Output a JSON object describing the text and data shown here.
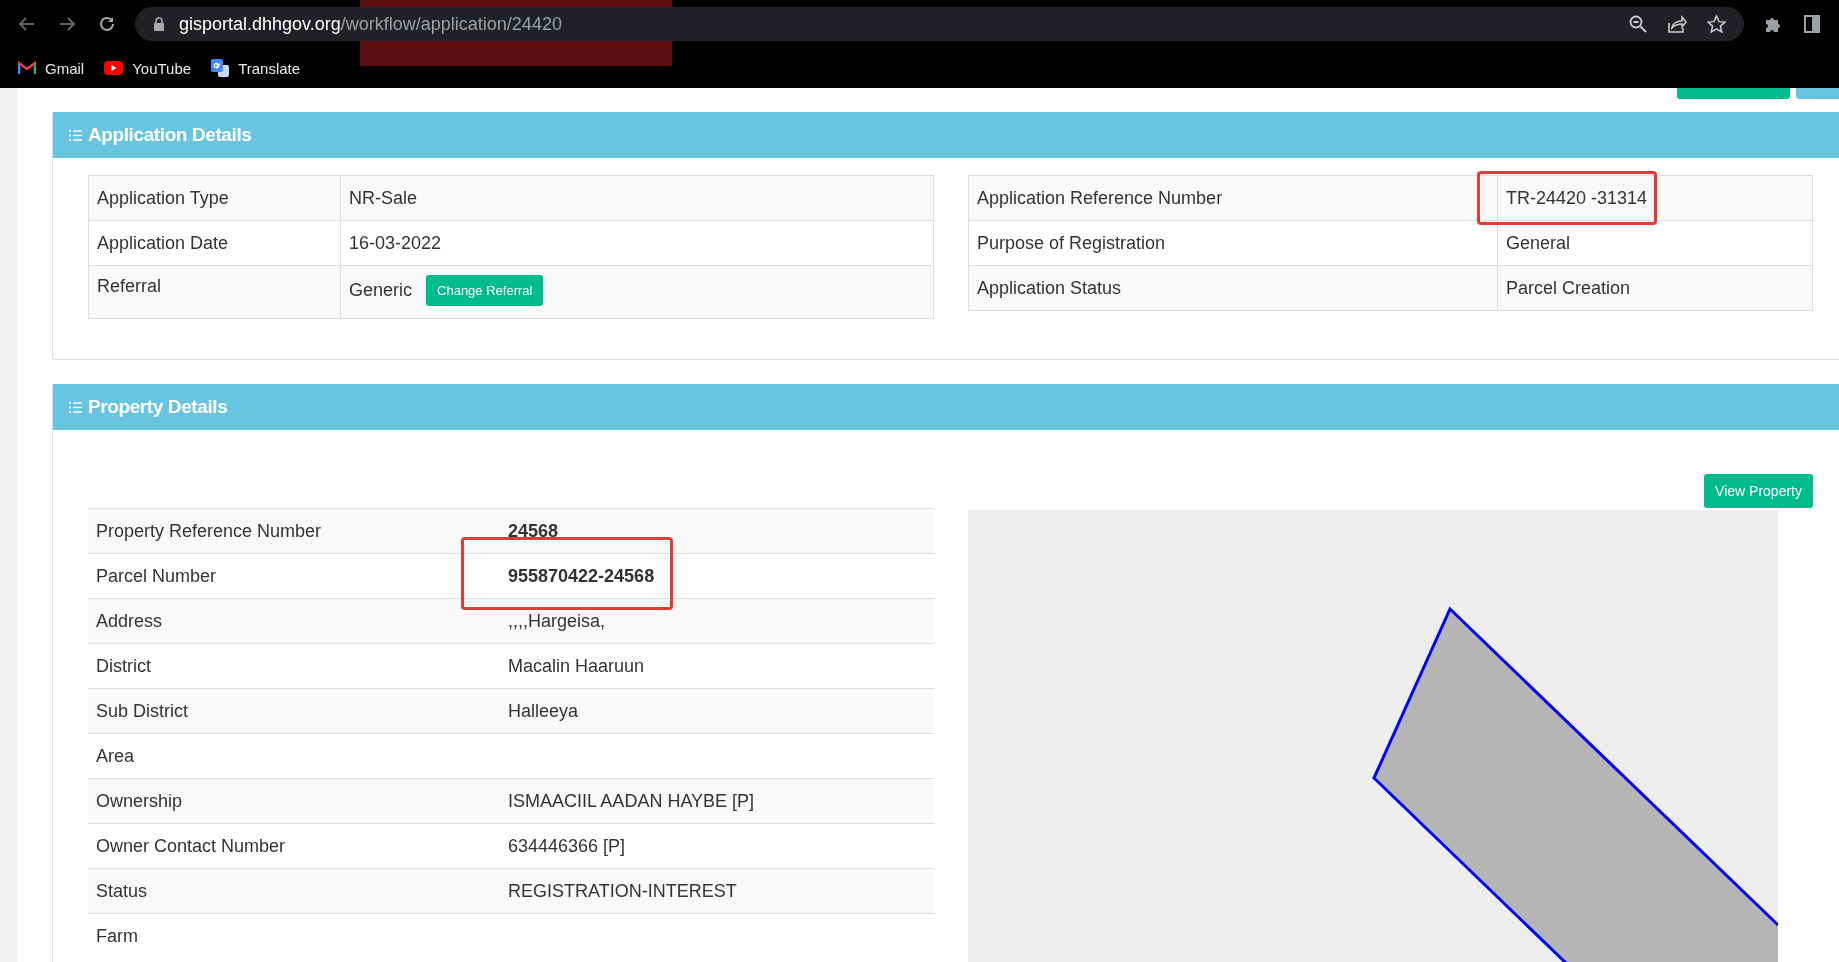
{
  "browser": {
    "url": {
      "host": "gisportal.dhhgov.org",
      "path": "/workflow/application/24420"
    },
    "bookmarks": [
      {
        "label": "Gmail",
        "kind": "gmail"
      },
      {
        "label": "YouTube",
        "kind": "youtube"
      },
      {
        "label": "Translate",
        "kind": "translate"
      }
    ]
  },
  "application_details": {
    "title": "Application Details",
    "left_rows": [
      {
        "label": "Application Type",
        "value": "NR-Sale",
        "highlighted": false
      },
      {
        "label": "Application Date",
        "value": "16-03-2022",
        "highlighted": false
      },
      {
        "label": "Referral",
        "value": "Generic",
        "button": "Change Referral",
        "highlighted": false
      }
    ],
    "right_rows": [
      {
        "label": "Application Reference Number",
        "value": "TR-24420 -31314",
        "highlighted": true
      },
      {
        "label": "Purpose of Registration",
        "value": "General",
        "highlighted": false
      },
      {
        "label": "Application Status",
        "value": "Parcel Creation",
        "highlighted": false
      }
    ]
  },
  "property_details": {
    "title": "Property Details",
    "button": "View Property",
    "rows": [
      {
        "label": "Property Reference Number",
        "value": "24568",
        "bold": true,
        "highlighted": false
      },
      {
        "label": "Parcel Number",
        "value": "955870422-24568",
        "bold": true,
        "highlighted": true
      },
      {
        "label": "Address",
        "value": ",,,,Hargeisa,",
        "bold": false,
        "highlighted": false
      },
      {
        "label": "District",
        "value": "Macalin Haaruun",
        "bold": false,
        "highlighted": false
      },
      {
        "label": "Sub District",
        "value": "Halleeya",
        "bold": false,
        "highlighted": false
      },
      {
        "label": "Area",
        "highlighted": false
      },
      {
        "label": "Ownership",
        "value": "ISMAACIIL AADAN HAYBE [P]",
        "bold": false,
        "highlighted": false
      },
      {
        "label": "Owner Contact Number",
        "value": "634446366 [P]",
        "bold": false,
        "highlighted": false
      },
      {
        "label": "Status",
        "value": "REGISTRATION-INTEREST",
        "bold": false,
        "highlighted": false
      },
      {
        "label": "Farm",
        "highlighted": false
      }
    ]
  }
}
